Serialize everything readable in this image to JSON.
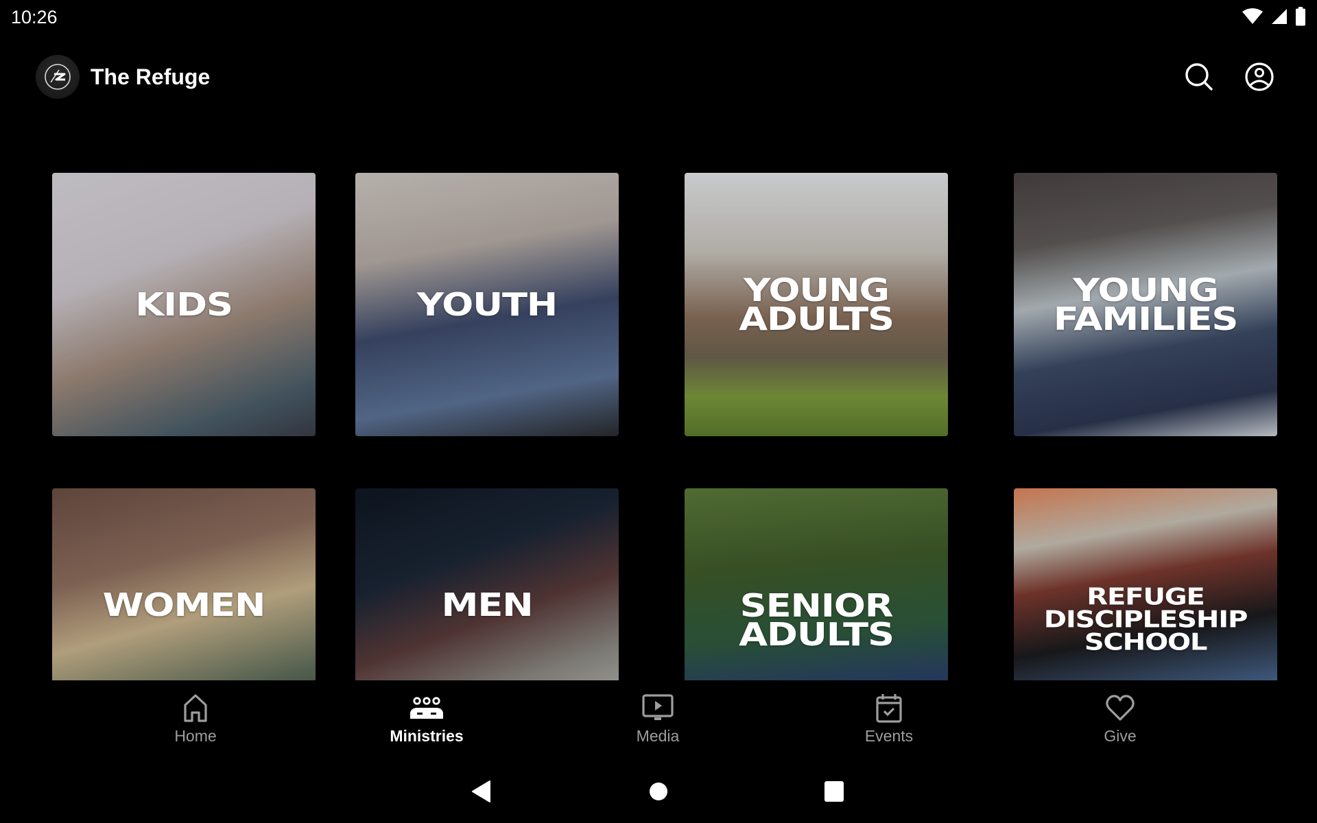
{
  "status_bar": {
    "time": "10:26",
    "icons": [
      "wifi-icon",
      "cellular-signal-icon",
      "battery-icon"
    ]
  },
  "app_bar": {
    "title": "The Refuge",
    "logo_icon": "refuge-logo-icon",
    "actions": [
      {
        "name": "search",
        "icon": "search-icon"
      },
      {
        "name": "account",
        "icon": "account-circle-icon"
      }
    ]
  },
  "ministries": [
    {
      "label": "Kids",
      "lines": [
        "KIDS"
      ]
    },
    {
      "label": "Youth",
      "lines": [
        "YOUTH"
      ]
    },
    {
      "label": "Young Adults",
      "lines": [
        "YOUNG",
        "ADULTS"
      ]
    },
    {
      "label": "Young Families",
      "lines": [
        "YOUNG",
        "FAMILIES"
      ]
    },
    {
      "label": "Women",
      "lines": [
        "WOMEN"
      ]
    },
    {
      "label": "Men",
      "lines": [
        "MEN"
      ]
    },
    {
      "label": "Senior Adults",
      "lines": [
        "SENIOR",
        "ADULTS"
      ]
    },
    {
      "label": "Refuge Discipleship School",
      "lines": [
        "REFUGE",
        "DISCIPLESHIP",
        "SCHOOL"
      ]
    }
  ],
  "bottom_nav": {
    "items": [
      {
        "label": "Home",
        "icon": "home-icon",
        "active": false
      },
      {
        "label": "Ministries",
        "icon": "groups-icon",
        "active": true
      },
      {
        "label": "Media",
        "icon": "media-play-icon",
        "active": false
      },
      {
        "label": "Events",
        "icon": "calendar-check-icon",
        "active": false
      },
      {
        "label": "Give",
        "icon": "heart-icon",
        "active": false
      }
    ],
    "active_color": "#ffffff",
    "inactive_color": "#9e9e9e"
  },
  "system_nav": {
    "buttons": [
      "back-icon",
      "home-circle-icon",
      "recents-icon"
    ]
  }
}
